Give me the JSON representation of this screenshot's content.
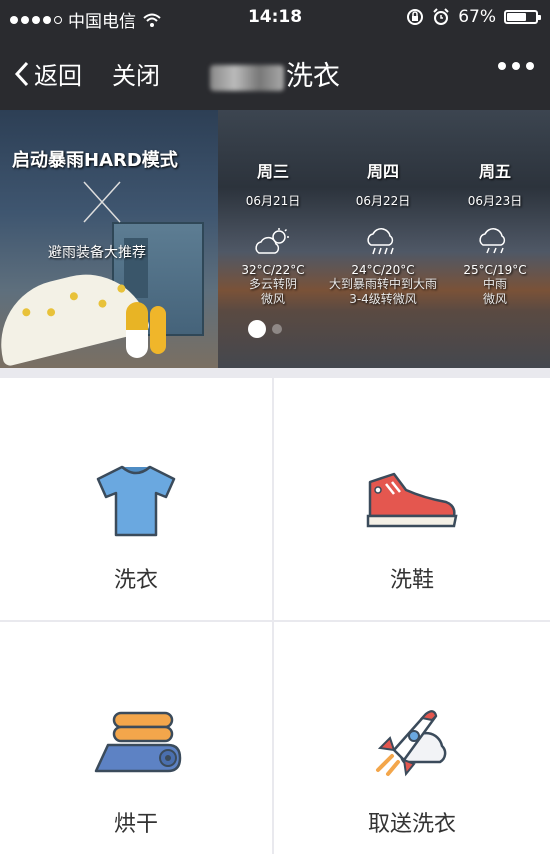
{
  "status_bar": {
    "carrier": "中国电信",
    "time": "14:18",
    "battery_percent": "67%",
    "battery_level": 0.67,
    "icons": [
      "signal-dots-icon",
      "wifi-icon",
      "rotation-lock-icon",
      "alarm-icon",
      "battery-icon"
    ]
  },
  "nav": {
    "back_label": "返回",
    "close_label": "关闭",
    "title": "洗衣",
    "more_icon": "more-dots-icon"
  },
  "banner": {
    "promo_title": "启动暴雨HARD模式",
    "promo_subtitle": "避雨装备大推荐",
    "forecast": [
      {
        "day": "周三",
        "date": "06月21日",
        "temp": "32°C/22°C",
        "desc1": "多云转阴",
        "desc2": "微风",
        "icon": "partly-cloudy-icon"
      },
      {
        "day": "周四",
        "date": "06月22日",
        "temp": "24°C/20°C",
        "desc1": "大到暴雨转中到大雨",
        "desc2": "3-4级转微风",
        "icon": "heavy-rain-icon"
      },
      {
        "day": "周五",
        "date": "06月23日",
        "temp": "25°C/19°C",
        "desc1": "中雨",
        "desc2": "微风",
        "icon": "rain-icon"
      }
    ]
  },
  "services": [
    {
      "label": "洗衣",
      "icon": "tshirt-icon"
    },
    {
      "label": "洗鞋",
      "icon": "sneaker-icon"
    },
    {
      "label": "烘干",
      "icon": "towel-icon"
    },
    {
      "label": "取送洗衣",
      "icon": "rocket-icon"
    }
  ],
  "colors": {
    "bar_bg": "#2a2b2f",
    "grid_gap": "#e9e9ee",
    "label_text": "#333333"
  }
}
